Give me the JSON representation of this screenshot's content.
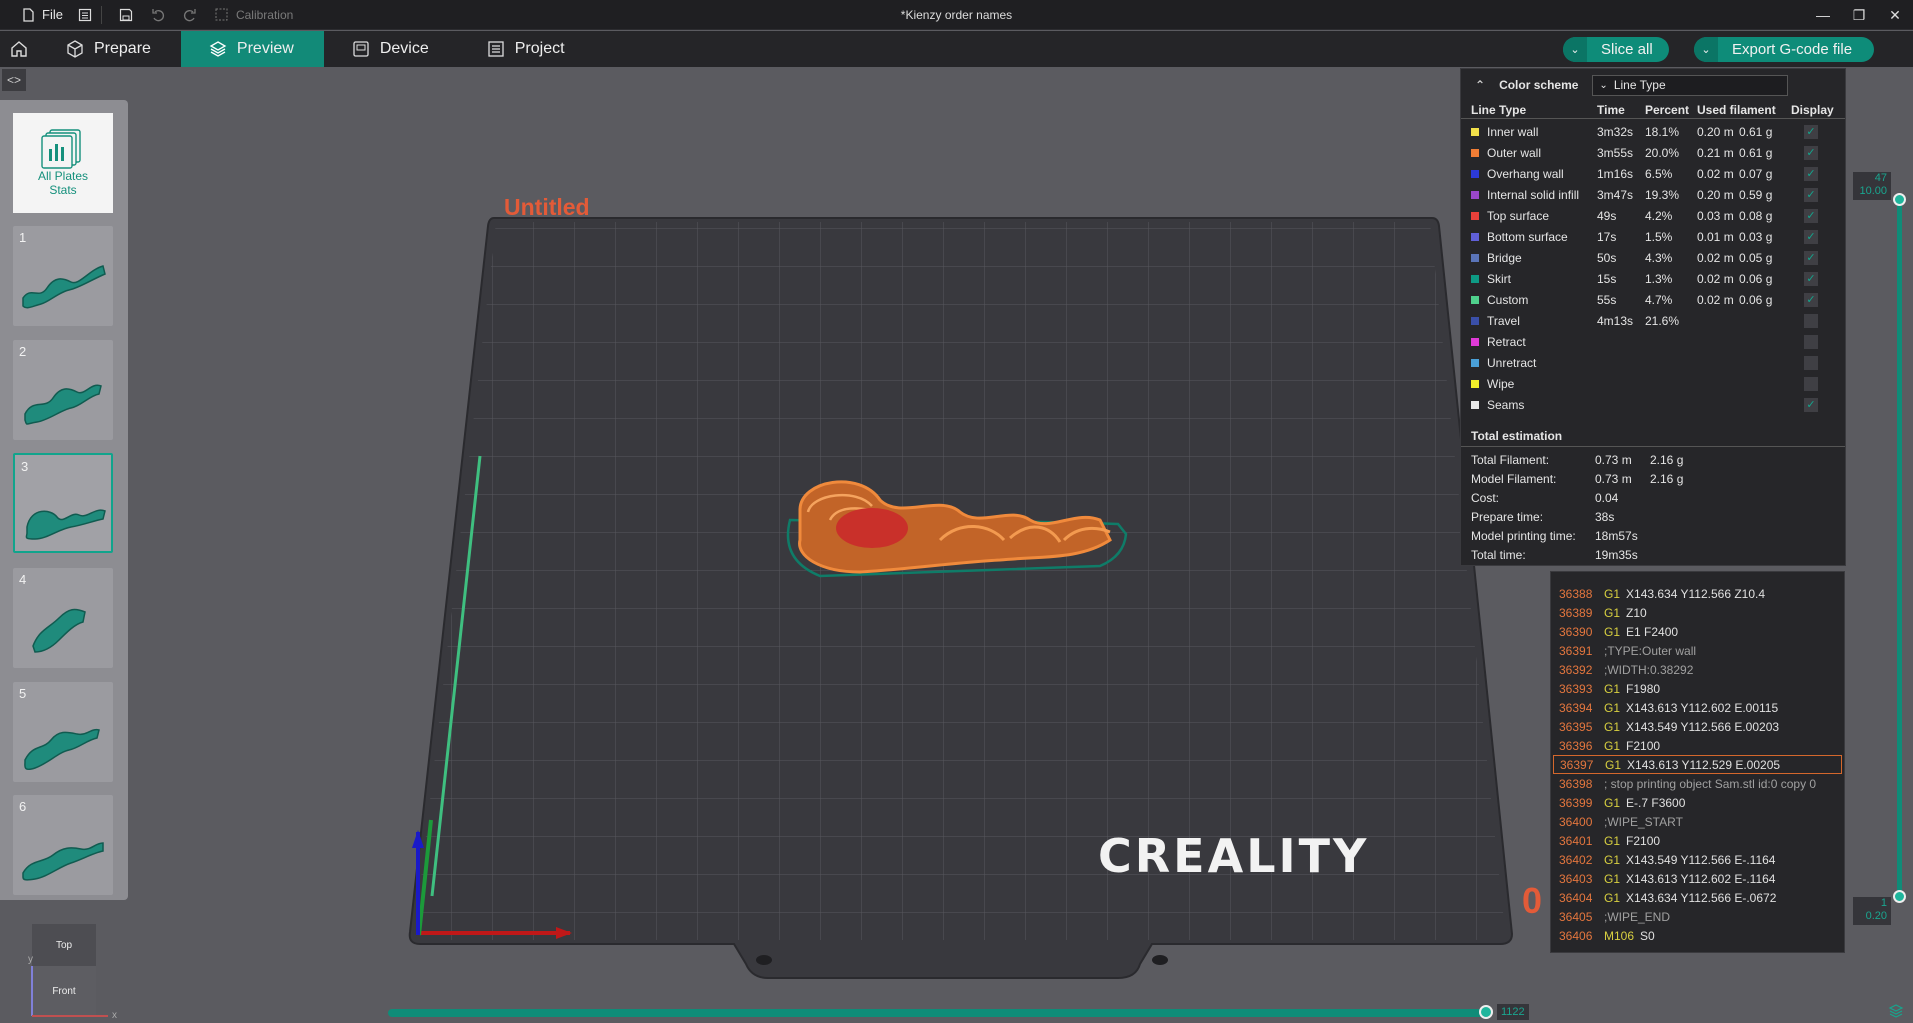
{
  "titlebar": {
    "file_label": "File",
    "calibration_label": "Calibration",
    "document_title": "*Kienzy order names"
  },
  "tabs": [
    {
      "label": "Prepare",
      "icon": "cube-icon"
    },
    {
      "label": "Preview",
      "icon": "layers-icon",
      "active": true
    },
    {
      "label": "Device",
      "icon": "device-icon"
    },
    {
      "label": "Project",
      "icon": "list-icon"
    }
  ],
  "actions": {
    "slice_all": "Slice all",
    "export_gcode": "Export G-code file"
  },
  "plates": {
    "all_plates_label_1": "All Plates",
    "all_plates_label_2": "Stats",
    "items": [
      {
        "number": "1"
      },
      {
        "number": "2"
      },
      {
        "number": "3",
        "selected": true
      },
      {
        "number": "4"
      },
      {
        "number": "5"
      },
      {
        "number": "6"
      }
    ]
  },
  "viewport": {
    "plate_name": "Untitled",
    "bed_brand": "CREALITY",
    "object_text": "Sam",
    "partial_number": "0"
  },
  "stats": {
    "color_scheme_label": "Color scheme",
    "color_scheme_value": "Line Type",
    "columns": {
      "line_type": "Line Type",
      "time": "Time",
      "percent": "Percent",
      "used_filament": "Used filament",
      "display": "Display"
    },
    "rows": [
      {
        "name": "Inner wall",
        "color": "#f2e04a",
        "time": "3m32s",
        "percent": "18.1%",
        "length": "0.20 m",
        "weight": "0.61 g",
        "display": true
      },
      {
        "name": "Outer wall",
        "color": "#f07d35",
        "time": "3m55s",
        "percent": "20.0%",
        "length": "0.21 m",
        "weight": "0.61 g",
        "display": true
      },
      {
        "name": "Overhang wall",
        "color": "#2c3ad6",
        "time": "1m16s",
        "percent": "6.5%",
        "length": "0.02 m",
        "weight": "0.07 g",
        "display": true
      },
      {
        "name": "Internal solid infill",
        "color": "#9a47c9",
        "time": "3m47s",
        "percent": "19.3%",
        "length": "0.20 m",
        "weight": "0.59 g",
        "display": true
      },
      {
        "name": "Top surface",
        "color": "#e8403a",
        "time": "49s",
        "percent": "4.2%",
        "length": "0.03 m",
        "weight": "0.08 g",
        "display": true
      },
      {
        "name": "Bottom surface",
        "color": "#6060d8",
        "time": "17s",
        "percent": "1.5%",
        "length": "0.01 m",
        "weight": "0.03 g",
        "display": true
      },
      {
        "name": "Bridge",
        "color": "#5a74b8",
        "time": "50s",
        "percent": "4.3%",
        "length": "0.02 m",
        "weight": "0.05 g",
        "display": true
      },
      {
        "name": "Skirt",
        "color": "#0e9a84",
        "time": "15s",
        "percent": "1.3%",
        "length": "0.02 m",
        "weight": "0.06 g",
        "display": true
      },
      {
        "name": "Custom",
        "color": "#4fd08c",
        "time": "55s",
        "percent": "4.7%",
        "length": "0.02 m",
        "weight": "0.06 g",
        "display": true
      },
      {
        "name": "Travel",
        "color": "#3a4fa8",
        "time": "4m13s",
        "percent": "21.6%",
        "length": "",
        "weight": "",
        "display": false
      },
      {
        "name": "Retract",
        "color": "#e03ad8",
        "time": "",
        "percent": "",
        "length": "",
        "weight": "",
        "display": false
      },
      {
        "name": "Unretract",
        "color": "#4aa0d8",
        "time": "",
        "percent": "",
        "length": "",
        "weight": "",
        "display": false
      },
      {
        "name": "Wipe",
        "color": "#f2ee2a",
        "time": "",
        "percent": "",
        "length": "",
        "weight": "",
        "display": false
      },
      {
        "name": "Seams",
        "color": "#e8e8e8",
        "time": "",
        "percent": "",
        "length": "",
        "weight": "",
        "display": true
      }
    ],
    "total": {
      "heading": "Total estimation",
      "rows": [
        {
          "label": "Total Filament:",
          "v1": "0.73 m",
          "v2": "2.16 g"
        },
        {
          "label": "Model Filament:",
          "v1": "0.73 m",
          "v2": "2.16 g"
        },
        {
          "label": "Cost:",
          "v1": "0.04",
          "v2": ""
        },
        {
          "label": "Prepare time:",
          "v1": "38s",
          "v2": ""
        },
        {
          "label": "Model printing time:",
          "v1": "18m57s",
          "v2": ""
        },
        {
          "label": "Total time:",
          "v1": "19m35s",
          "v2": ""
        }
      ]
    }
  },
  "gcode": [
    {
      "n": "36388",
      "cmd": "G1",
      "args": "X143.634 Y112.566 Z10.4"
    },
    {
      "n": "36389",
      "cmd": "G1",
      "args": "Z10"
    },
    {
      "n": "36390",
      "cmd": "G1",
      "args": "E1 F2400"
    },
    {
      "n": "36391",
      "cmd": "",
      "args": ";TYPE:Outer wall"
    },
    {
      "n": "36392",
      "cmd": "",
      "args": ";WIDTH:0.38292"
    },
    {
      "n": "36393",
      "cmd": "G1",
      "args": "F1980"
    },
    {
      "n": "36394",
      "cmd": "G1",
      "args": "X143.613 Y112.602 E.00115"
    },
    {
      "n": "36395",
      "cmd": "G1",
      "args": "X143.549 Y112.566 E.00203"
    },
    {
      "n": "36396",
      "cmd": "G1",
      "args": "F2100"
    },
    {
      "n": "36397",
      "cmd": "G1",
      "args": "X143.613 Y112.529 E.00205",
      "highlight": true
    },
    {
      "n": "36398",
      "cmd": "",
      "args": "; stop printing object Sam.stl id:0 copy 0"
    },
    {
      "n": "36399",
      "cmd": "G1",
      "args": "E-.7 F3600"
    },
    {
      "n": "36400",
      "cmd": "",
      "args": ";WIPE_START"
    },
    {
      "n": "36401",
      "cmd": "G1",
      "args": "F2100"
    },
    {
      "n": "36402",
      "cmd": "G1",
      "args": "X143.549 Y112.566 E-.1164"
    },
    {
      "n": "36403",
      "cmd": "G1",
      "args": "X143.613 Y112.602 E-.1164"
    },
    {
      "n": "36404",
      "cmd": "G1",
      "args": "X143.634 Y112.566 E-.0672"
    },
    {
      "n": "36405",
      "cmd": "",
      "args": ";WIPE_END"
    },
    {
      "n": "36406",
      "cmd": "M106",
      "args": "S0"
    }
  ],
  "layer_slider": {
    "top_layer": "47",
    "top_height": "10.00",
    "bottom_layer": "1",
    "bottom_height": "0.20"
  },
  "move_slider": {
    "value": "1122"
  },
  "view_cube": {
    "top_label": "Top",
    "front_label": "Front",
    "axis_y": "y",
    "axis_x": "x"
  }
}
